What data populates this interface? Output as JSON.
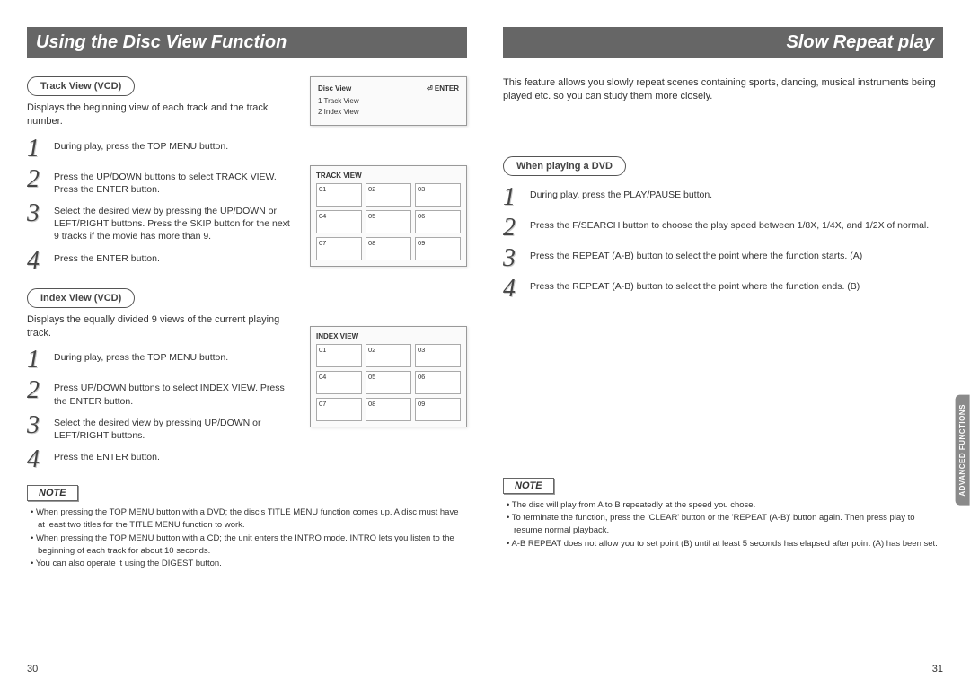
{
  "leftPage": {
    "title": "Using the Disc View Function",
    "section1": {
      "heading": "Track View (VCD)",
      "desc": "Displays the beginning view of each track and the track number.",
      "steps": [
        "During play, press the TOP MENU button.",
        "Press the UP/DOWN buttons to select TRACK VIEW. Press the ENTER button.",
        "Select the desired view by pressing the UP/DOWN or LEFT/RIGHT buttons. Press the SKIP button for the next 9 tracks if the movie has more than 9.",
        "Press the ENTER button."
      ]
    },
    "section2": {
      "heading": "Index View (VCD)",
      "desc": "Displays the equally divided 9 views of the current playing track.",
      "steps": [
        "During play, press the TOP MENU button.",
        "Press UP/DOWN buttons to select INDEX VIEW. Press the ENTER button.",
        "Select the desired view by pressing UP/DOWN or LEFT/RIGHT buttons.",
        "Press the ENTER button."
      ]
    },
    "osd": {
      "title": "Disc View",
      "enter": "ENTER",
      "items": [
        "1 Track View",
        "2 Index View"
      ]
    },
    "trackGrid": {
      "title": "TRACK VIEW",
      "cells": [
        "01",
        "02",
        "03",
        "04",
        "05",
        "06",
        "07",
        "08",
        "09"
      ]
    },
    "indexGrid": {
      "title": "INDEX VIEW",
      "cells": [
        "01",
        "02",
        "03",
        "04",
        "05",
        "06",
        "07",
        "08",
        "09"
      ]
    },
    "noteLabel": "NOTE",
    "notes": [
      "• When pressing the TOP MENU button with a DVD; the disc's TITLE MENU function comes up. A disc must have at least two titles for the TITLE MENU function to work.",
      "• When pressing the TOP MENU button with a CD; the unit enters the INTRO mode. INTRO lets you listen to the beginning of each track for about 10 seconds.",
      "• You can also operate it using the DIGEST button."
    ],
    "pageNum": "30"
  },
  "rightPage": {
    "title": "Slow Repeat play",
    "intro": "This feature allows you slowly repeat scenes containing sports, dancing, musical instruments being played etc. so you can study them more closely.",
    "section": {
      "heading": "When playing a DVD",
      "steps": [
        "During play, press the PLAY/PAUSE button.",
        "Press the F/SEARCH button to choose the play speed between 1/8X, 1/4X, and 1/2X of normal.",
        "Press the REPEAT (A-B) button to select the point where the function starts. (A)",
        "Press the REPEAT (A-B) button to select the point where the function ends. (B)"
      ]
    },
    "noteLabel": "NOTE",
    "notes": [
      "• The disc will play from A to B repeatedly at the speed you chose.",
      "• To terminate the function, press the 'CLEAR' button or the 'REPEAT (A-B)' button again. Then press play to resume normal playback.",
      "• A-B REPEAT does not allow you to set point (B) until at least 5 seconds has elapsed after point (A) has been set."
    ],
    "pageNum": "31"
  },
  "sideTab": "ADVANCED FUNCTIONS"
}
